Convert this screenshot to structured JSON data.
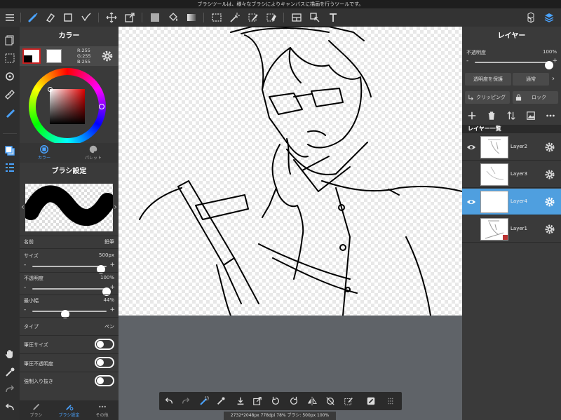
{
  "hint": "ブラシツールは、様々なブラシによりキャンバスに描画を行うツールです。",
  "color_panel": {
    "title": "カラー",
    "rgb": {
      "r": "R:255",
      "g": "G:255",
      "b": "B:255"
    },
    "tabs": [
      {
        "label": "カラー"
      },
      {
        "label": "パレット"
      }
    ]
  },
  "brush_panel": {
    "title": "ブラシ設定",
    "name_label": "名前",
    "name_value": "鉛筆",
    "size_label": "サイズ",
    "size_value": "500px",
    "size_pct": 0.92,
    "opacity_label": "不透明度",
    "opacity_value": "100%",
    "opacity_pct": 1.0,
    "minwidth_label": "最小幅",
    "minwidth_value": "44%",
    "minwidth_pct": 0.44,
    "type_label": "タイプ",
    "type_value": "ペン",
    "pressure_size_label": "筆圧サイズ",
    "pressure_opacity_label": "筆圧不透明度",
    "force_label": "強制入り抜き",
    "minus": "-",
    "plus": "+",
    "bottom_tabs": [
      {
        "label": "ブラシ"
      },
      {
        "label": "ブラシ設定"
      },
      {
        "label": "その他"
      }
    ]
  },
  "layer_panel": {
    "title": "レイヤー",
    "opacity_label": "不透明度",
    "opacity_value": "100%",
    "opacity_pct": 1.0,
    "protect_label": "透明度を保護",
    "blend_label": "通常",
    "clipping_label": "クリッピング",
    "lock_label": "ロック",
    "list_title": "レイヤー一覧",
    "minus": "-",
    "plus": "+",
    "layers": [
      {
        "name": "Layer2",
        "visible": true,
        "selected": false
      },
      {
        "name": "Layer3",
        "visible": false,
        "selected": false
      },
      {
        "name": "Layer4",
        "visible": true,
        "selected": true
      },
      {
        "name": "Layer1",
        "visible": false,
        "selected": false
      }
    ]
  },
  "infobar": "2732*2048px 778dpi 78% ブラシ: 500px 100%",
  "colors": {
    "accent": "#4aa3ff",
    "selected_layer": "#4f9fdf",
    "panel": "#3a3a3a"
  }
}
